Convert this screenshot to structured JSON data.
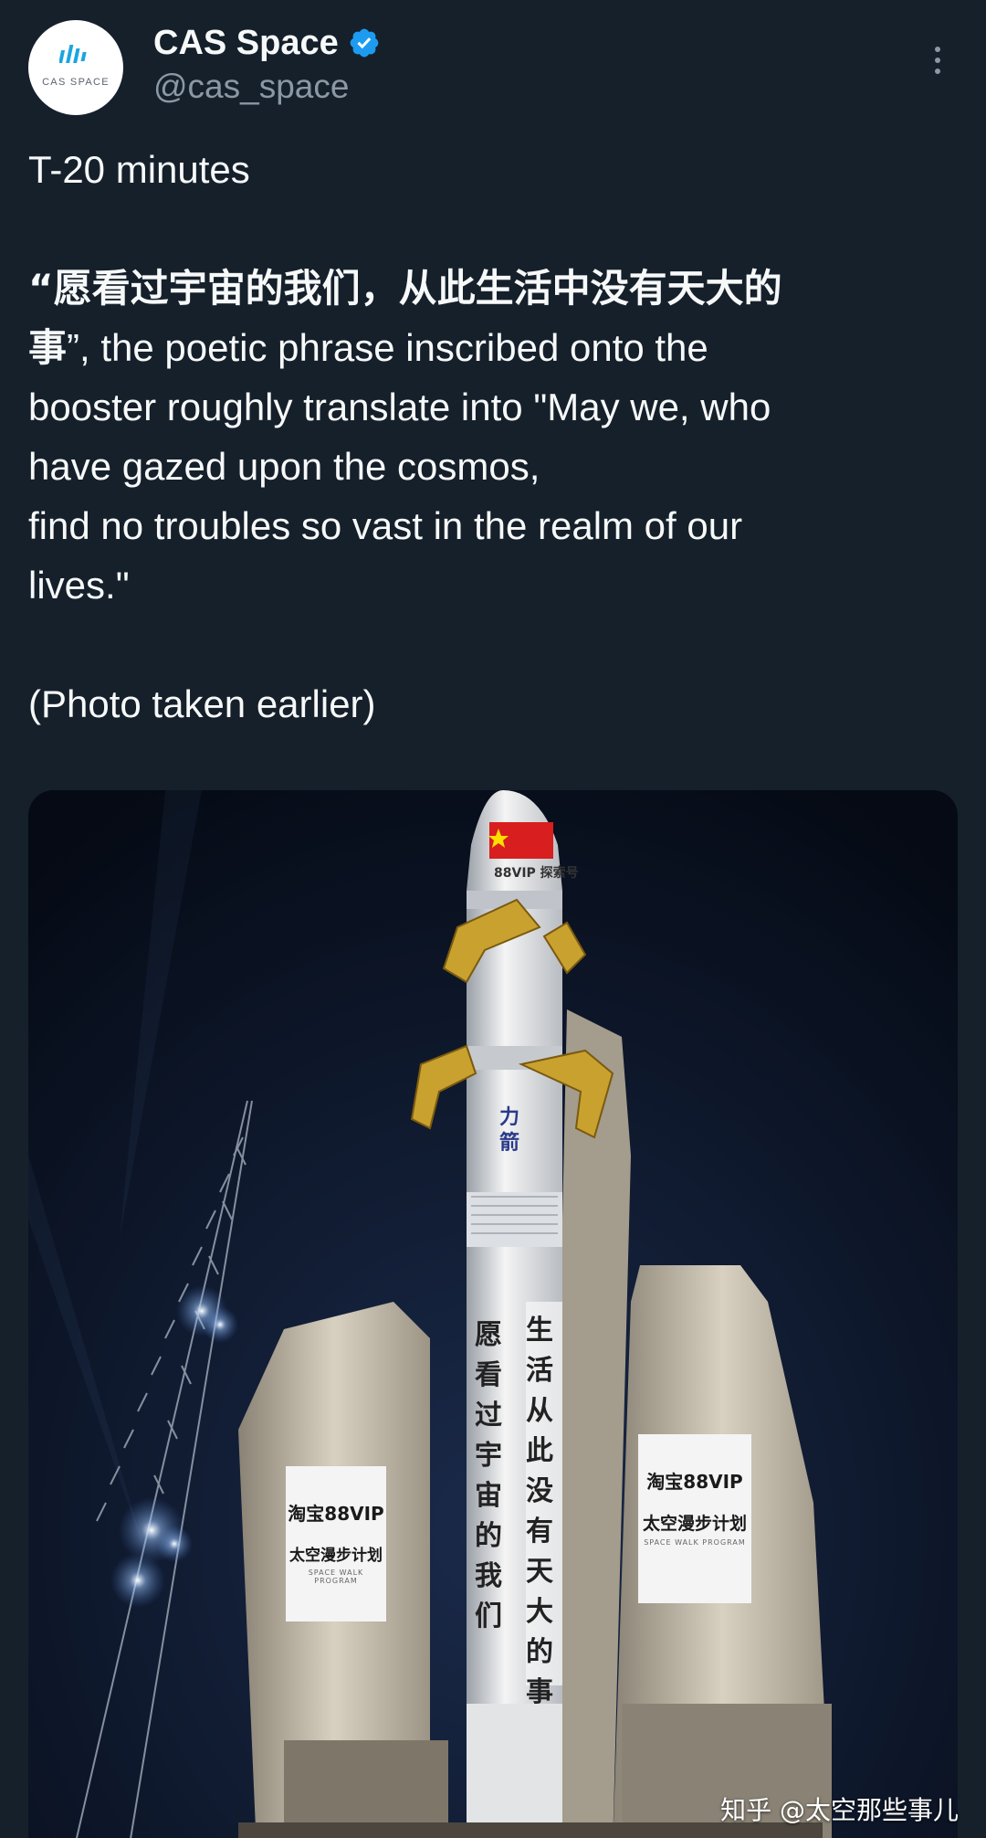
{
  "author": {
    "display_name": "CAS Space",
    "handle": "@cas_space",
    "avatar_text": "CAS SPACE",
    "verified": true,
    "verified_color": "#1d9bf0"
  },
  "tweet": {
    "lines": [
      "T-20 minutes",
      "",
      "",
      "事”, the poetic phrase inscribed onto the",
      "booster roughly translate into \"May we, who",
      "have gazed upon the cosmos,",
      "find no troubles so vast in the realm of our",
      "lives.\"",
      "",
      "(Photo taken earlier)"
    ],
    "quote_line": "“愿看过宇宙的我们，从此生活中没有天大的"
  },
  "photo": {
    "booster_left_text": [
      "愿",
      "看",
      "过",
      "宇",
      "宙",
      "的",
      "我",
      "们"
    ],
    "booster_right_text": [
      "生",
      "活",
      "从",
      "此",
      "没",
      "有",
      "天",
      "大",
      "的",
      "事"
    ],
    "board_left": {
      "line1": "淘宝88VIP",
      "line2": "太空漫步计划",
      "line3": "SPACE WALK PROGRAM"
    },
    "board_right": {
      "line1": "淘宝88VIP",
      "line2": "太空漫步计划",
      "line3": "SPACE WALK PROGRAM"
    },
    "fairing_label": "88VIP 探索号",
    "booster_logo": "力箭"
  },
  "watermark": "知乎 @太空那些事儿",
  "colors": {
    "background": "#15202b",
    "text": "#f7f9f9",
    "secondary": "#8b98a5"
  }
}
